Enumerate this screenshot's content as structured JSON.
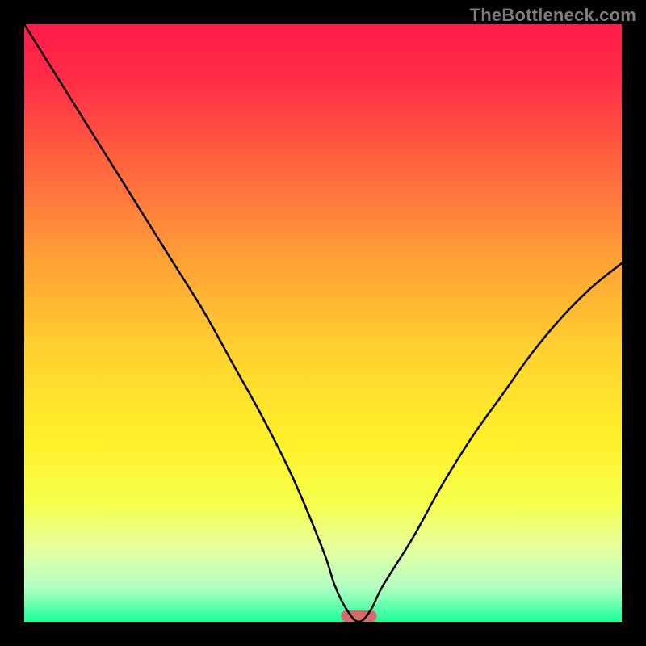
{
  "watermark": "TheBottleneck.com",
  "chart_data": {
    "type": "line",
    "title": "",
    "xlabel": "",
    "ylabel": "",
    "xlim": [
      0,
      100
    ],
    "ylim": [
      0,
      100
    ],
    "grid": false,
    "series": [
      {
        "name": "bottleneck-curve",
        "x": [
          0,
          5,
          10,
          15,
          20,
          25,
          30,
          35,
          40,
          45,
          50,
          52,
          54,
          56,
          58,
          60,
          65,
          70,
          75,
          80,
          85,
          90,
          95,
          100
        ],
        "y": [
          100,
          92,
          84,
          76,
          68,
          60,
          52,
          43,
          34,
          24,
          12,
          6,
          2,
          0,
          2,
          6,
          14,
          23,
          31,
          38,
          45,
          51,
          56,
          60
        ]
      }
    ],
    "marker": {
      "name": "optimal-range",
      "x_center": 56,
      "width": 6,
      "color": "#d46a6a"
    },
    "background_gradient": {
      "stops": [
        {
          "offset": 0.0,
          "color": "#ff1a4a"
        },
        {
          "offset": 0.1,
          "color": "#ff2f46"
        },
        {
          "offset": 0.25,
          "color": "#ff6a3e"
        },
        {
          "offset": 0.4,
          "color": "#ffa236"
        },
        {
          "offset": 0.55,
          "color": "#ffd22f"
        },
        {
          "offset": 0.7,
          "color": "#fff12a"
        },
        {
          "offset": 0.8,
          "color": "#f7ff4b"
        },
        {
          "offset": 0.88,
          "color": "#e4ffa0"
        },
        {
          "offset": 0.94,
          "color": "#b6ffc3"
        },
        {
          "offset": 0.97,
          "color": "#6effb0"
        },
        {
          "offset": 1.0,
          "color": "#1aff9a"
        }
      ]
    }
  }
}
